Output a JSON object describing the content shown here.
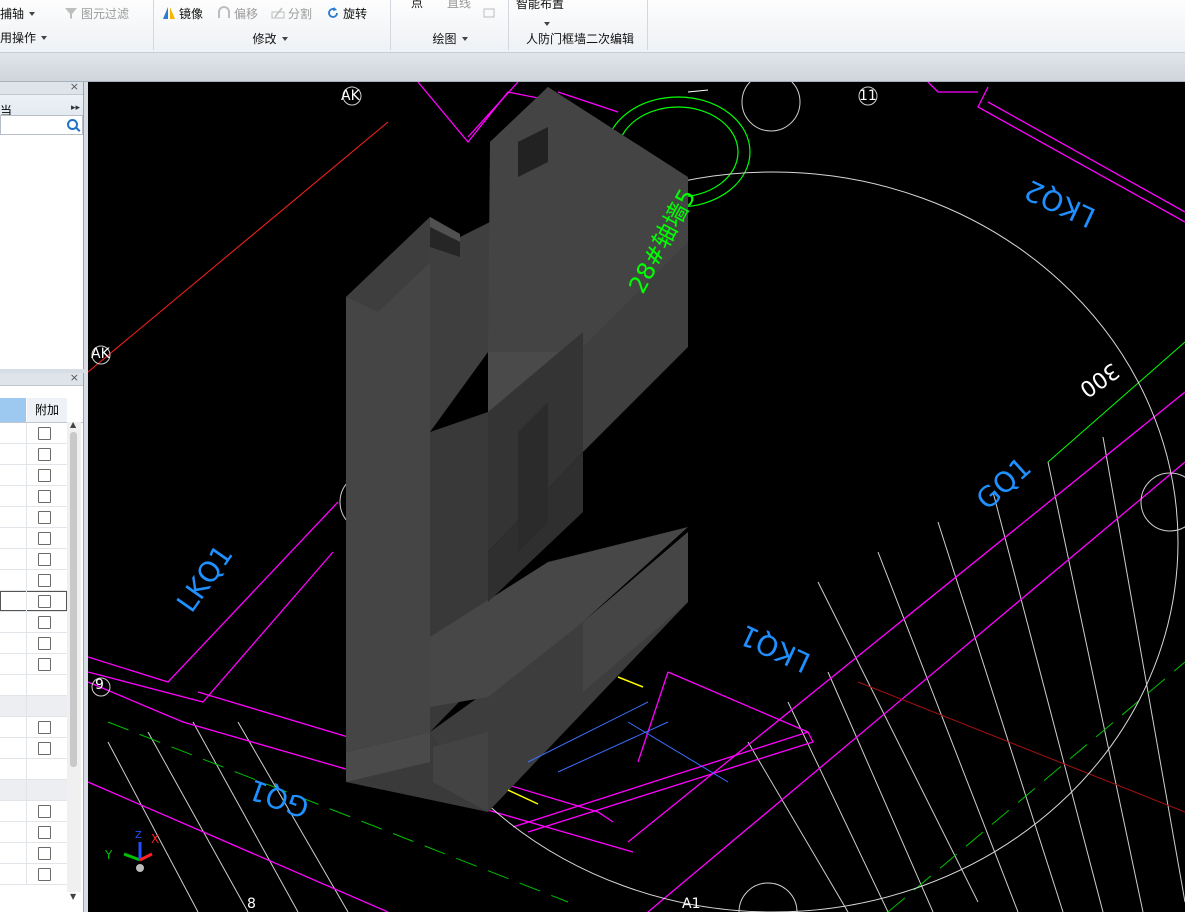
{
  "ribbon": {
    "g1": {
      "item_top": "捕轴",
      "item_bottom": "用操作"
    },
    "g2": {
      "filter": "图元过滤"
    },
    "g3": {
      "mirror": "镜像",
      "offset": "偏移",
      "split": "分割",
      "rotate": "旋转",
      "label": "修改"
    },
    "g4": {
      "point": "点",
      "line": "直线",
      "label": "绘图"
    },
    "g5": {
      "smart": "智能布置",
      "label": "人防门框墙二次编辑"
    }
  },
  "left": {
    "top_panel": {
      "close": "×",
      "expand": "▸▸",
      "tab_fragment": "当"
    },
    "bottom_panel": {
      "close": "×",
      "col_extra": "附加",
      "rows": 22
    }
  },
  "viewport": {
    "axis_labels": {
      "ak_top": "AK",
      "ak_left": "AK",
      "n11": "11",
      "n9": "9",
      "n8": "8",
      "a1": "A1"
    },
    "cad_text": {
      "green_note": "28#轴墙5",
      "dim": "300",
      "lkq1_left": "LKQ1",
      "lkq1_bottom": "LKQ1",
      "lkq2": "LKQ2",
      "gq1": "GQ1",
      "gq1_bottom": "GQ1"
    },
    "ucs": {
      "x": "X",
      "y": "Y",
      "z": "Z"
    },
    "colors": {
      "magenta": "#ff00ff",
      "green": "#00ff00",
      "blue": "#1e90ff",
      "grey_solid": "#474747",
      "white": "#ffffff",
      "red": "#ff2020",
      "yellow": "#ffff00"
    }
  },
  "icons": [
    "mirror-icon",
    "offset-icon",
    "split-icon",
    "rotate-icon",
    "filter-icon",
    "line-icon",
    "search-icon",
    "close-icon",
    "expand-icon",
    "checkbox-icon",
    "ucs-icon"
  ]
}
